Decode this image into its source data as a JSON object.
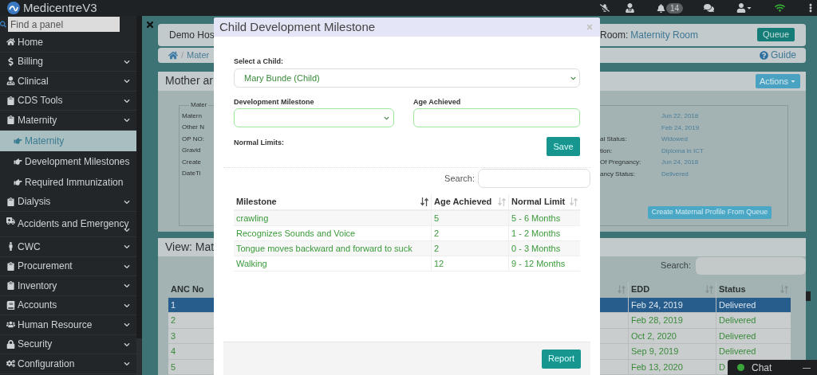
{
  "app": {
    "title": "MedicentreV3",
    "notification_count": "14"
  },
  "sidebar": {
    "search": {
      "placeholder": "Find a panel"
    },
    "items": [
      {
        "label": "Home",
        "has_menu": false
      },
      {
        "label": "Billing",
        "has_menu": true
      },
      {
        "label": "Clinical",
        "has_menu": true
      },
      {
        "label": "CDS Tools",
        "has_menu": true
      },
      {
        "label": "Maternity",
        "has_menu": true,
        "children": [
          {
            "label": "Maternity",
            "selected": true
          },
          {
            "label": "Development Milestones",
            "selected": false
          },
          {
            "label": "Required Immunization",
            "selected": false
          }
        ]
      },
      {
        "label": "Dialysis",
        "has_menu": true
      },
      {
        "label": "Accidents and Emergency",
        "has_menu": true
      },
      {
        "label": "CWC",
        "has_menu": true
      },
      {
        "label": "Procurement",
        "has_menu": true
      },
      {
        "label": "Inventory",
        "has_menu": true
      },
      {
        "label": "Accounts",
        "has_menu": true
      },
      {
        "label": "Human Resource",
        "has_menu": true
      },
      {
        "label": "Security",
        "has_menu": true
      },
      {
        "label": "Configuration",
        "has_menu": true
      }
    ]
  },
  "background": {
    "header": {
      "hospital": "Demo Hos",
      "room_label": "Room:",
      "room": "Maternity Room",
      "queue_button": "Queue"
    },
    "breadcrumb": {
      "separator": "/",
      "item": "Mater",
      "guide": "Guide"
    },
    "profile_panel": {
      "title": "Mother ar",
      "actions_button": "Actions",
      "legend": "Mater",
      "left_labels": [
        "Matern",
        "Other N",
        "OP NO:",
        "Gravid",
        "Create",
        "DateTi"
      ],
      "right_fields": [
        {
          "value": "Jun 22, 2018"
        },
        {
          "value": "Feb 24, 2019"
        },
        {
          "label": "al Status:",
          "value": "Widowed"
        },
        {
          "label": "tion:",
          "value": "Diploma in ICT"
        },
        {
          "label": "Of Pregnancy:",
          "value": "Jun 24, 2018"
        },
        {
          "label": "ancy Status:",
          "value": "Delivered"
        }
      ],
      "create_button": "Create Maternal Profile From Queue"
    },
    "list_panel": {
      "title": "View: Mat",
      "search_label": "Search:",
      "columns": [
        "ANC No",
        "EDD",
        "Status"
      ],
      "rows": [
        {
          "anc_no": "1",
          "edd": "Feb 24, 2019",
          "status": "Delivered",
          "selected": true
        },
        {
          "anc_no": "2",
          "edd": "Feb 28, 2019",
          "status": "Delivered",
          "selected": false
        },
        {
          "anc_no": "3",
          "edd": "Oct 2, 2020",
          "status": "Delivered",
          "selected": false
        },
        {
          "anc_no": "4",
          "edd": "Sep 9, 2019",
          "status": "Delivered",
          "selected": false
        },
        {
          "anc_no": "5",
          "edd": "Feb 13, 2020",
          "status": "D",
          "selected": false
        }
      ]
    }
  },
  "dialog": {
    "title": "Child Development Milestone",
    "child_label": "Select a Child:",
    "child_value": "Mary Bunde (Child)",
    "milestone_label": "Development Milestone",
    "age_label": "Age Achieved",
    "normal_limits_label": "Normal Limits:",
    "save_button": "Save",
    "search_label": "Search:",
    "columns": [
      {
        "label": "Milestone",
        "sorted": true
      },
      {
        "label": "Age Achieved",
        "sorted": false
      },
      {
        "label": "Normal Limit",
        "sorted": false
      }
    ],
    "rows": [
      [
        "crawling",
        "5",
        "5 - 6 Months"
      ],
      [
        "Recognizes Sounds and Voice",
        "2",
        "1 - 2 Months"
      ],
      [
        "Tongue moves backward and forward to suck",
        "2",
        "0 - 3 Months"
      ],
      [
        "Walking",
        "12",
        "9 - 12 Months"
      ]
    ],
    "report_button": "Report"
  },
  "chat": {
    "label": "Chat",
    "online": true,
    "minimize": "—"
  }
}
